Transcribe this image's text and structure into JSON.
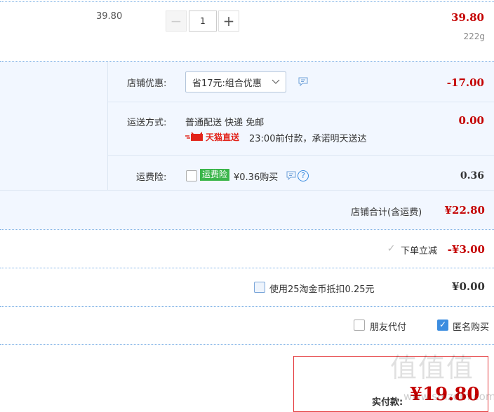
{
  "item": {
    "unit_price": "39.80",
    "qty": "1",
    "minus_label": "−",
    "plus_label": "+",
    "subtotal": "39.80",
    "weight": "222g"
  },
  "shop": {
    "discount_label": "店铺优惠:",
    "discount_select": "省17元:组合优惠",
    "discount_amount": "-17.00",
    "ship_label": "运送方式:",
    "ship_method": "普通配送 快递 免邮",
    "tmall_label": "天猫直送",
    "ship_promise": "23:00前付款，承诺明天送达",
    "ship_amount": "0.00",
    "ins_label": "运费险:",
    "ins_badge": "运费险",
    "ins_price": "¥0.36购买",
    "ins_amount": "0.36",
    "help_glyph": "?",
    "total_label": "店铺合计(含运费)",
    "total_amount": "¥22.80"
  },
  "order": {
    "instant_label": "下单立减",
    "instant_amount": "-¥3.00",
    "coins_label": "使用25淘金币抵扣0.25元",
    "coins_amount": "¥0.00",
    "friend_pay_label": "朋友代付",
    "anonymous_label": "匿名购买",
    "pay_label": "实付款:",
    "pay_amount": "¥19.80",
    "watermark": "值值值",
    "watermark_site": "www.smzdm.com"
  }
}
